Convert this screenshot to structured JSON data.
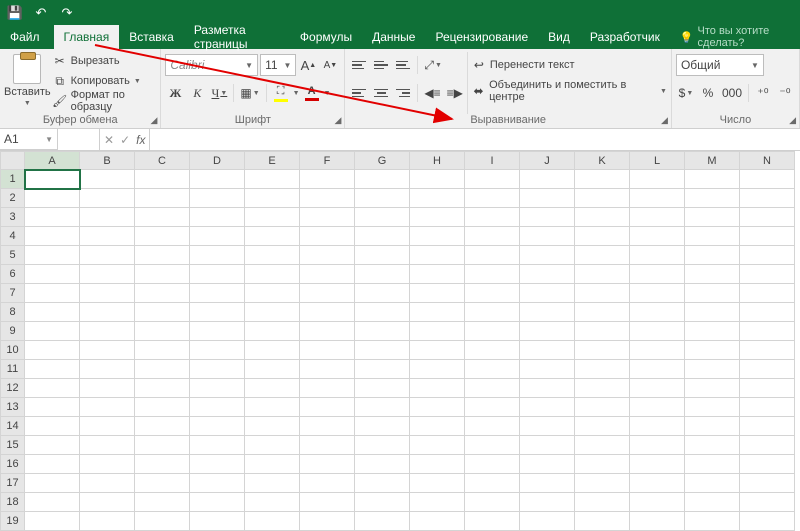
{
  "titlebar": {
    "save_icon": "💾",
    "undo_icon": "↶",
    "redo_icon": "↷"
  },
  "tabs": {
    "file": "Файл",
    "home": "Главная",
    "insert": "Вставка",
    "layout": "Разметка страницы",
    "formulas": "Формулы",
    "data": "Данные",
    "review": "Рецензирование",
    "view": "Вид",
    "developer": "Разработчик"
  },
  "tell_me": "Что вы хотите сделать?",
  "clipboard": {
    "paste": "Вставить",
    "cut": "Вырезать",
    "copy": "Копировать",
    "format_painter": "Формат по образцу",
    "group_label": "Буфер обмена"
  },
  "font": {
    "family": "Calibri",
    "size": "11",
    "increase": "A",
    "decrease": "A",
    "bold": "Ж",
    "italic": "К",
    "underline": "Ч",
    "group_label": "Шрифт"
  },
  "alignment": {
    "wrap": "Перенести текст",
    "merge": "Объединить и поместить в центре",
    "group_label": "Выравнивание"
  },
  "number": {
    "format": "Общий",
    "group_label": "Число"
  },
  "namebox": "A1",
  "fx": "fx",
  "columns": [
    "A",
    "B",
    "C",
    "D",
    "E",
    "F",
    "G",
    "H",
    "I",
    "J",
    "K",
    "L",
    "M",
    "N"
  ],
  "rows": [
    "1",
    "2",
    "3",
    "4",
    "5",
    "6",
    "7",
    "8",
    "9",
    "10",
    "11",
    "12",
    "13",
    "14",
    "15",
    "16",
    "17",
    "18",
    "19"
  ]
}
